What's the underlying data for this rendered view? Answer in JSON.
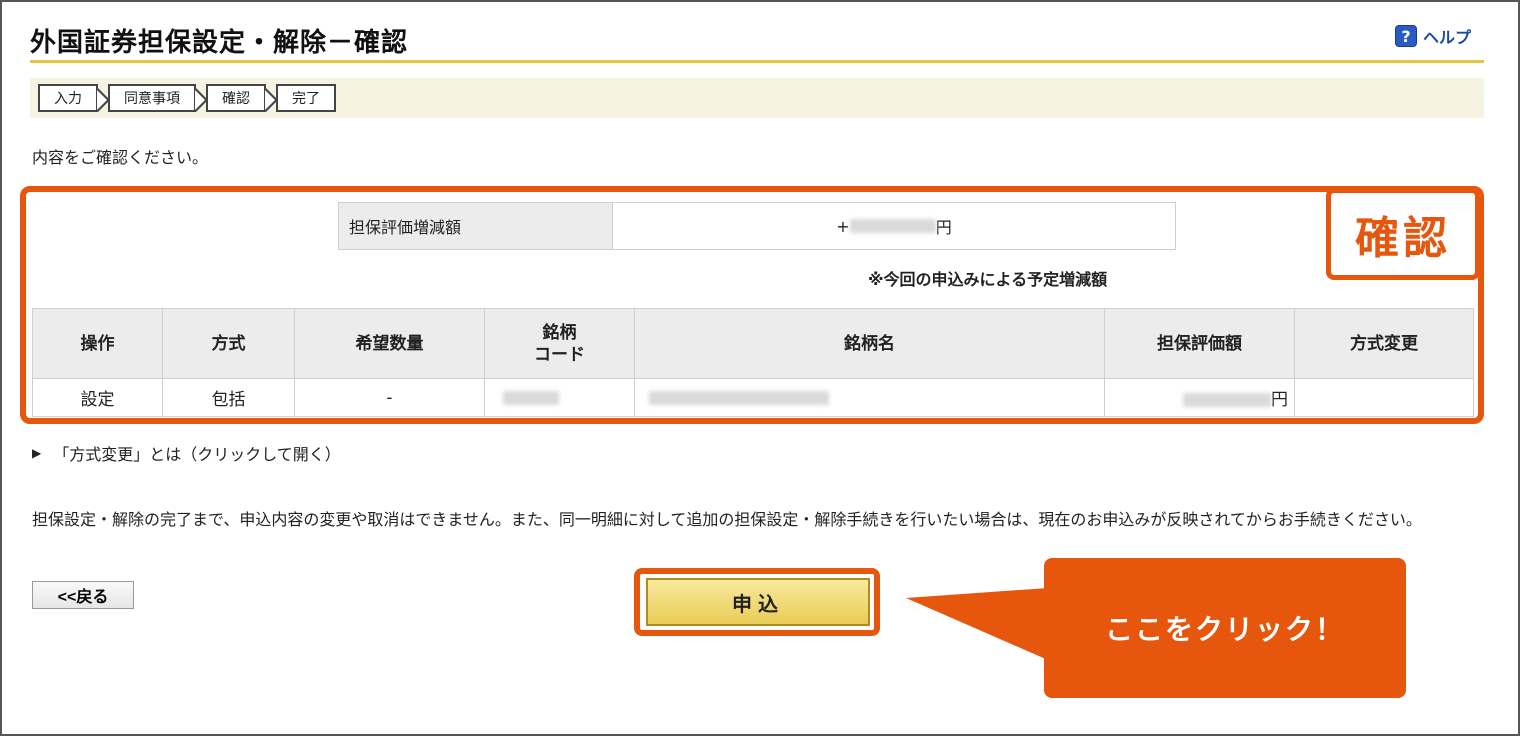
{
  "header": {
    "title": "外国証券担保設定・解除－確認",
    "help_label": "ヘルプ",
    "help_icon": "question-mark-icon"
  },
  "steps": [
    {
      "label": "入力"
    },
    {
      "label": "同意事項"
    },
    {
      "label": "確認"
    },
    {
      "label": "完了"
    }
  ],
  "instruction": "内容をご確認ください。",
  "annotation": {
    "confirm_tag": "確認",
    "callout": "ここをクリック！",
    "accent_color": "#e6560c"
  },
  "evaluation": {
    "label": "担保評価増減額",
    "value_prefix": "+",
    "value_suffix": "円",
    "note": "※今回の申込みによる予定増減額"
  },
  "table": {
    "headers": [
      "操作",
      "方式",
      "希望数量",
      "銘柄\nコード",
      "銘柄名",
      "担保評価額",
      "方式変更"
    ],
    "rows": [
      {
        "operation": "設定",
        "method": "包括",
        "quantity": "-",
        "code": "",
        "name": "",
        "value_suffix": "円",
        "method_change": ""
      }
    ]
  },
  "toggle": {
    "label": "「方式変更」とは（クリックして開く）"
  },
  "notice": "担保設定・解除の完了まで、申込内容の変更や取消はできません。また、同一明細に対して追加の担保設定・解除手続きを行いたい場合は、現在のお申込みが反映されてからお手続きください。",
  "buttons": {
    "back": "<<戻る",
    "submit": "申込"
  }
}
